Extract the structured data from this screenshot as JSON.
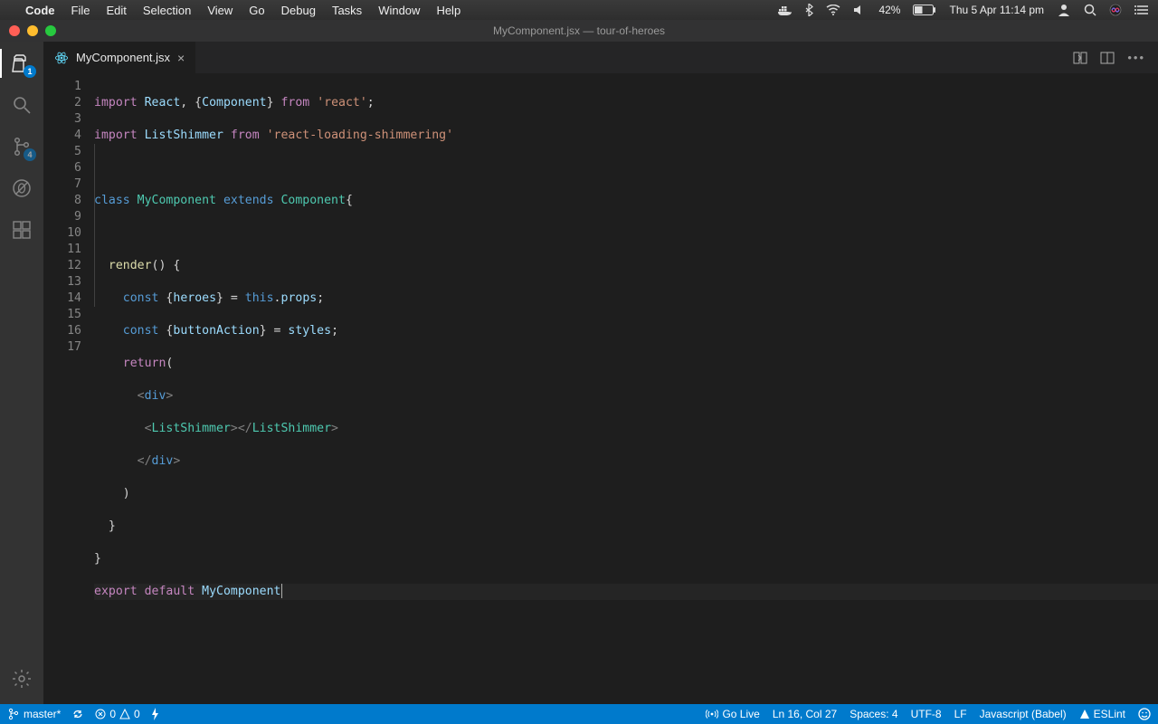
{
  "menubar": {
    "app": "Code",
    "items": [
      "File",
      "Edit",
      "Selection",
      "View",
      "Go",
      "Debug",
      "Tasks",
      "Window",
      "Help"
    ],
    "battery": "42%",
    "clock": "Thu 5 Apr  11:14 pm"
  },
  "window": {
    "title": "MyComponent.jsx — tour-of-heroes"
  },
  "activity": {
    "explorer_badge": "1",
    "scm_badge": "4"
  },
  "tab": {
    "filename": "MyComponent.jsx"
  },
  "code": {
    "line_count": 17,
    "lines": {
      "l1a": "import",
      "l1b": "React",
      "l1c": "Component",
      "l1d": "from",
      "l1e": "'react'",
      "l2a": "import",
      "l2b": "ListShimmer",
      "l2c": "from",
      "l2d": "'react-loading-shimmering'",
      "l4a": "class",
      "l4b": "MyComponent",
      "l4c": "extends",
      "l4d": "Component",
      "l6a": "render",
      "l7a": "const",
      "l7b": "heroes",
      "l7c": "this",
      "l7d": "props",
      "l8a": "const",
      "l8b": "buttonAction",
      "l8c": "styles",
      "l9a": "return",
      "l10a": "div",
      "l11a": "ListShimmer",
      "l11b": "ListShimmer",
      "l12a": "div",
      "l16a": "export",
      "l16b": "default",
      "l16c": "MyComponent"
    }
  },
  "status": {
    "branch": "master*",
    "errors": "0",
    "warnings": "0",
    "golive": "Go Live",
    "cursor": "Ln 16, Col 27",
    "spaces": "Spaces: 4",
    "encoding": "UTF-8",
    "eol": "LF",
    "language": "Javascript (Babel)",
    "eslint": "ESLint"
  }
}
